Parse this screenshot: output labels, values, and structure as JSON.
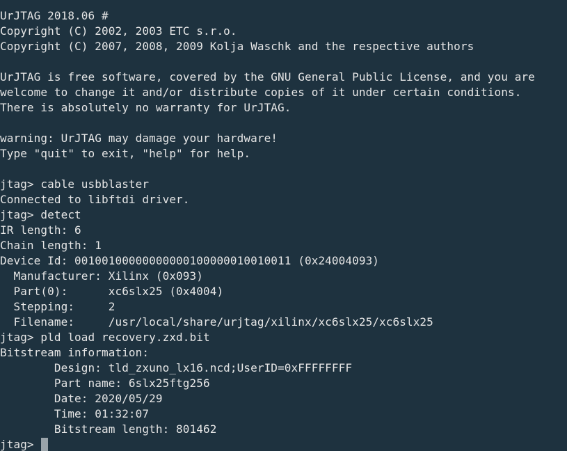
{
  "colors": {
    "background": "#1e323f",
    "text": "#e6e6e6",
    "cursor": "#9aa4aa"
  },
  "terminal": {
    "lines": [
      "UrJTAG 2018.06 #",
      "Copyright (C) 2002, 2003 ETC s.r.o.",
      "Copyright (C) 2007, 2008, 2009 Kolja Waschk and the respective authors",
      "",
      "UrJTAG is free software, covered by the GNU General Public License, and you are",
      "welcome to change it and/or distribute copies of it under certain conditions.",
      "There is absolutely no warranty for UrJTAG.",
      "",
      "warning: UrJTAG may damage your hardware!",
      "Type \"quit\" to exit, \"help\" for help.",
      "",
      "jtag> cable usbblaster",
      "Connected to libftdi driver.",
      "jtag> detect",
      "IR length: 6",
      "Chain length: 1",
      "Device Id: 00100100000000000100000010010011 (0x24004093)",
      "  Manufacturer: Xilinx (0x093)",
      "  Part(0):      xc6slx25 (0x4004)",
      "  Stepping:     2",
      "  Filename:     /usr/local/share/urjtag/xilinx/xc6slx25/xc6slx25",
      "jtag> pld load recovery.zxd.bit",
      "Bitstream information:",
      "        Design: tld_zxuno_lx16.ncd;UserID=0xFFFFFFFF",
      "        Part name: 6slx25ftg256",
      "        Date: 2020/05/29",
      "        Time: 01:32:07",
      "        Bitstream length: 801462"
    ],
    "prompt": "jtag> "
  }
}
